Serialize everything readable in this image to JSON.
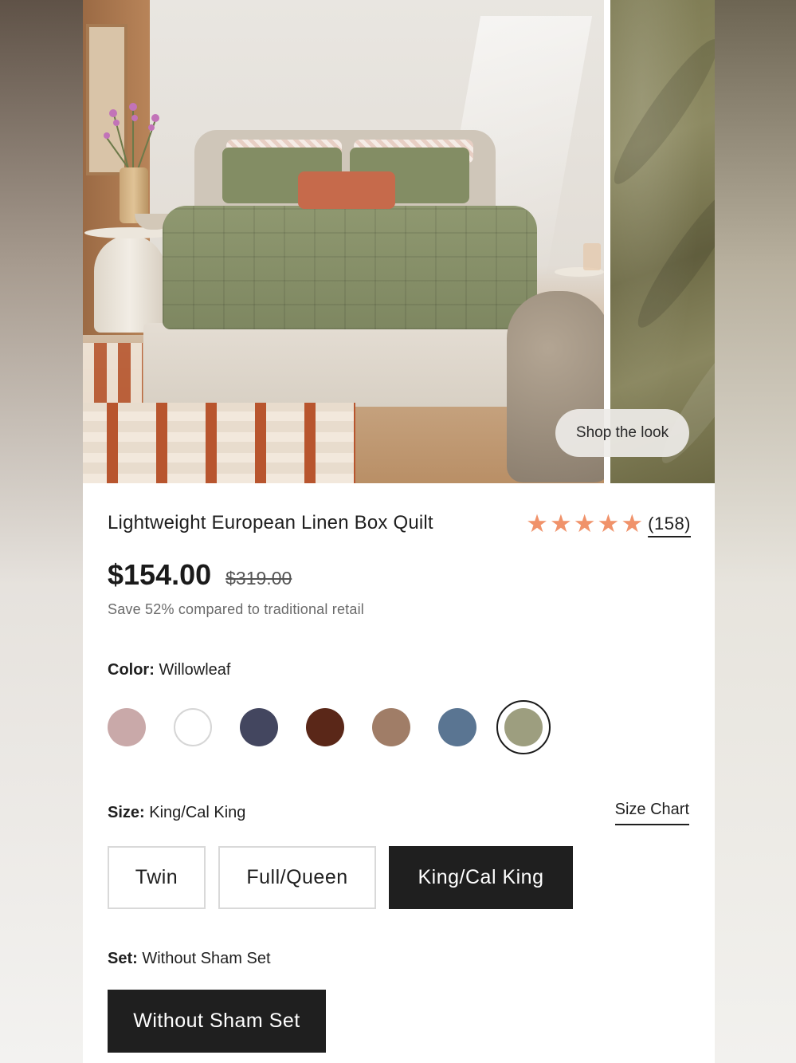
{
  "hero": {
    "shop_the_look_label": "Shop the look"
  },
  "product": {
    "title": "Lightweight European Linen Box Quilt",
    "rating_stars": 5,
    "review_count": "(158)",
    "price": "$154.00",
    "original_price": "$319.00",
    "savings_text": "Save 52% compared to traditional retail"
  },
  "color": {
    "label": "Color:",
    "selected": "Willowleaf",
    "swatches": [
      {
        "name": "dusty-rose",
        "hex": "#c9a9a9"
      },
      {
        "name": "white",
        "hex": "#ffffff"
      },
      {
        "name": "navy",
        "hex": "#43465f"
      },
      {
        "name": "rust-brown",
        "hex": "#5a2718"
      },
      {
        "name": "clay",
        "hex": "#a07d67"
      },
      {
        "name": "slate-blue",
        "hex": "#5a7592"
      },
      {
        "name": "willowleaf",
        "hex": "#9d9e7f",
        "selected": true
      }
    ]
  },
  "size": {
    "label": "Size:",
    "selected": "King/Cal King",
    "size_chart_label": "Size Chart",
    "options": [
      "Twin",
      "Full/Queen",
      "King/Cal King"
    ]
  },
  "set": {
    "label": "Set:",
    "selected": "Without Sham Set",
    "options": [
      "Without Sham Set"
    ]
  },
  "colors": {
    "star": "#f0926a",
    "selected_button_bg": "#1f1f1f"
  }
}
